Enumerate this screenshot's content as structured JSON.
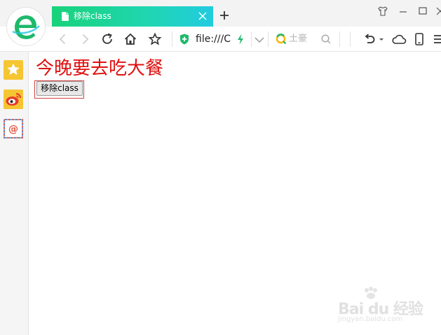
{
  "browser": {
    "tab": {
      "title": "移除class"
    },
    "address": {
      "text": "file:///C"
    },
    "search": {
      "placeholder": "土豪"
    },
    "accent_colors": {
      "tab_start": "#19d27a",
      "tab_end": "#22cbe0",
      "logo": "#1db96a"
    }
  },
  "sidebar": {
    "items": [
      {
        "icon": "favorites-star-icon"
      },
      {
        "icon": "weibo-icon"
      },
      {
        "icon": "email-at-icon"
      }
    ]
  },
  "page": {
    "heading": "今晚要去吃大餐",
    "heading_color": "#e01010",
    "button_label": "移除class"
  },
  "watermark": {
    "brand": "Bai du 经验",
    "url": "jingyan.baidu.com"
  }
}
